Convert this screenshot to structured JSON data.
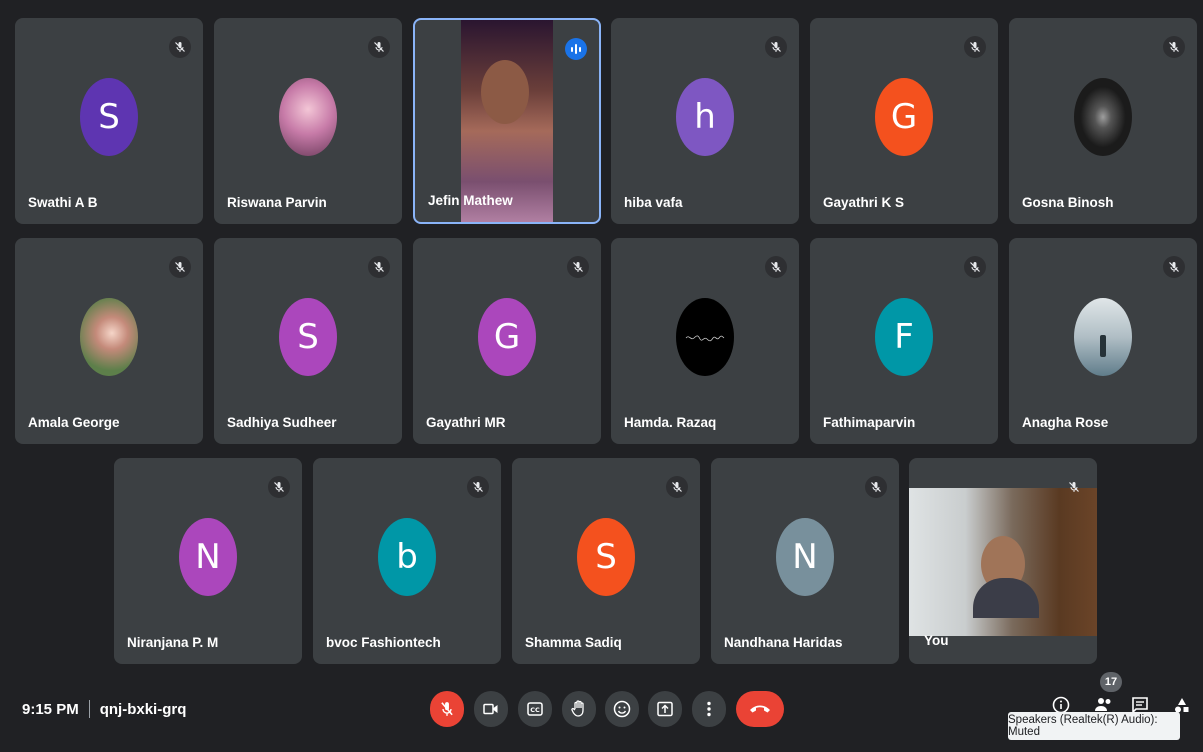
{
  "participants": [
    {
      "name": "Swathi A B",
      "initial": "S",
      "color": "#5e35b1",
      "type": "initial",
      "muted": true
    },
    {
      "name": "Riswana Parvin",
      "type": "photo",
      "muted": true,
      "photo_bg": "#c77ba8"
    },
    {
      "name": "Jefin Mathew",
      "type": "video",
      "speaking": true
    },
    {
      "name": "hiba vafa",
      "initial": "h",
      "color": "#7e57c2",
      "type": "initial",
      "muted": true
    },
    {
      "name": "Gayathri K S",
      "initial": "G",
      "color": "#f4511e",
      "type": "initial",
      "muted": true
    },
    {
      "name": "Gosna Binosh",
      "type": "photo",
      "muted": true,
      "photo_bg": "#1b1b1b"
    },
    {
      "name": "Amala George",
      "type": "photo",
      "muted": true,
      "photo_bg": "#5d7f4a"
    },
    {
      "name": "Sadhiya Sudheer",
      "initial": "S",
      "color": "#ab47bc",
      "type": "initial",
      "muted": true
    },
    {
      "name": "Gayathri MR",
      "initial": "G",
      "color": "#ab47bc",
      "type": "initial",
      "muted": true
    },
    {
      "name": "Hamda. Razaq",
      "type": "photo",
      "muted": true,
      "photo_bg": "#000000"
    },
    {
      "name": "Fathimaparvin",
      "initial": "F",
      "color": "#0097a7",
      "type": "initial",
      "muted": true
    },
    {
      "name": "Anagha Rose",
      "type": "photo",
      "muted": true,
      "photo_bg": "#b0bec5"
    },
    {
      "name": "Niranjana P. M",
      "initial": "N",
      "color": "#ab47bc",
      "type": "initial",
      "muted": true
    },
    {
      "name": "bvoc Fashiontech",
      "initial": "b",
      "color": "#0097a7",
      "type": "initial",
      "muted": true
    },
    {
      "name": "Shamma Sadiq",
      "initial": "S",
      "color": "#f4511e",
      "type": "initial",
      "muted": true
    },
    {
      "name": "Nandhana Haridas",
      "initial": "N",
      "color": "#78909c",
      "type": "initial",
      "muted": true
    },
    {
      "name": "You",
      "type": "self-video",
      "muted": true
    }
  ],
  "meeting": {
    "time": "9:15 PM",
    "code": "qnj-bxki-grq"
  },
  "controls": [
    "mic-off-icon",
    "camera-icon",
    "captions-icon",
    "raise-hand-icon",
    "emoji-icon",
    "present-icon",
    "more-options-icon",
    "end-call-icon"
  ],
  "people_count": "17",
  "tooltip": "Speakers (Realtek(R) Audio): Muted",
  "colors": {
    "background": "#202124",
    "tile": "#3c4043",
    "accent": "#8ab4f8",
    "danger": "#ea4335"
  }
}
